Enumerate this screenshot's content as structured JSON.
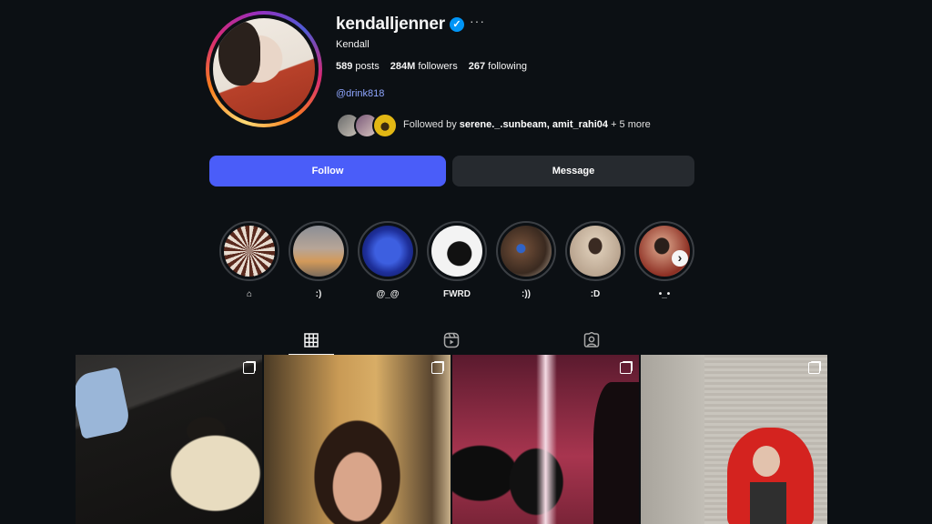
{
  "profile": {
    "username": "kendalljenner",
    "verified": true,
    "more_label": "···",
    "full_name": "Kendall",
    "posts_count": "589",
    "posts_label": "posts",
    "followers_count": "284M",
    "followers_label": "followers",
    "following_count": "267",
    "following_label": "following",
    "link": "@drink818",
    "followed_by_prefix": "Followed by",
    "followed_by_names": "serene._.sunbeam, amit_rahi04",
    "followed_by_suffix": "+ 5 more"
  },
  "actions": {
    "follow_label": "Follow",
    "message_label": "Message"
  },
  "highlights": [
    {
      "label": "⌂"
    },
    {
      "label": ":)"
    },
    {
      "label": "@_@"
    },
    {
      "label": "FWRD"
    },
    {
      "label": ":))"
    },
    {
      "label": ":D"
    },
    {
      "label": "•_•"
    }
  ],
  "tabs": [
    {
      "name": "posts",
      "icon": "grid-icon",
      "active": true
    },
    {
      "name": "reels",
      "icon": "reels-icon",
      "active": false
    },
    {
      "name": "tagged",
      "icon": "tagged-icon",
      "active": false
    }
  ],
  "colors": {
    "background": "#0c1014",
    "follow_button": "#4a5df9",
    "message_button": "#262a2f",
    "link": "#8fa6ff",
    "verified_badge": "#0095f6"
  }
}
